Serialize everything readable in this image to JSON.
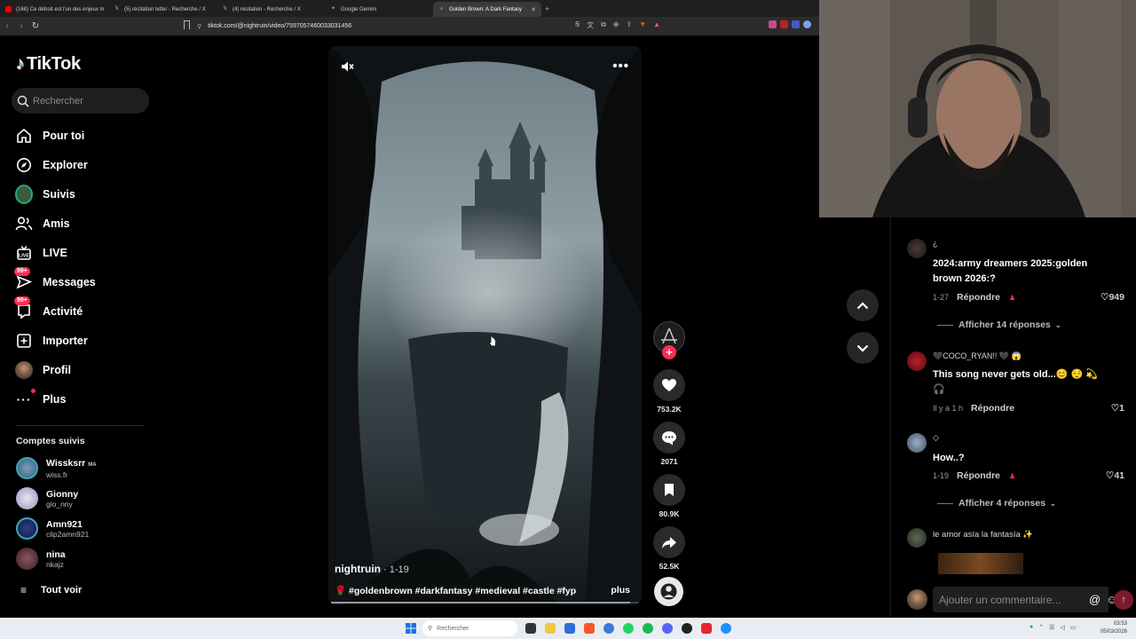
{
  "browser": {
    "tabs": [
      {
        "title": "(168) Ce détroit est l'un des enjeux m",
        "icon": "youtube-icon",
        "active": false
      },
      {
        "title": "(5) récitation letter - Recherche / X",
        "icon": "x-icon",
        "active": false
      },
      {
        "title": "(4) récitation - Recherche / X",
        "icon": "x-icon",
        "active": false
      },
      {
        "title": "Google Gemini",
        "icon": "gemini-icon",
        "active": false
      },
      {
        "title": "Golden Brown: A Dark Fantasy",
        "icon": "tiktok-icon",
        "active": true
      }
    ],
    "new_tab": "+",
    "url": "tiktok.com/@nightruin/video/7597057460033031456"
  },
  "sidebar": {
    "logo": "TikTok",
    "search_placeholder": "Rechercher",
    "nav": [
      {
        "label": "Pour toi",
        "icon": "home-icon"
      },
      {
        "label": "Explorer",
        "icon": "compass-icon"
      },
      {
        "label": "Suivis",
        "icon": "following-avatar-icon"
      },
      {
        "label": "Amis",
        "icon": "friends-icon"
      },
      {
        "label": "LIVE",
        "icon": "live-icon"
      },
      {
        "label": "Messages",
        "icon": "messages-icon",
        "badge": "99+"
      },
      {
        "label": "Activité",
        "icon": "activity-icon",
        "badge": "99+"
      },
      {
        "label": "Importer",
        "icon": "upload-icon"
      },
      {
        "label": "Profil",
        "icon": "profile-avatar-icon"
      },
      {
        "label": "Plus",
        "icon": "more-dots-icon"
      }
    ],
    "following_title": "Comptes suivis",
    "following": [
      {
        "name": "Wissksrr",
        "tag": "MA",
        "handle": "wiss.fr"
      },
      {
        "name": "Gionny",
        "tag": "",
        "handle": "gio_nny"
      },
      {
        "name": "Amn921",
        "tag": "",
        "handle": "clip2amn921"
      },
      {
        "name": "nina",
        "tag": "",
        "handle": "nkajz"
      }
    ],
    "see_all": "Tout voir"
  },
  "video": {
    "author": "nightruin",
    "date": " · 1-19",
    "caption": "🌹 #goldenbrown #darkfantasy #medieval #castle #fyp",
    "more_label": "plus",
    "progress": 0.97
  },
  "actions": {
    "likes": "753.2K",
    "comments": "2071",
    "saves": "80.9K",
    "shares": "52.5K"
  },
  "comments": [
    {
      "user": "¿",
      "text": "2024:army dreamers 2025:golden brown 2026:?",
      "time": "1-27",
      "reply": "Répondre",
      "likes": "949",
      "replies": "Afficher 14 réponses"
    },
    {
      "user": "🖤COCO_RYAN!! 🖤 😱",
      "text": "This song never gets old...😊 😌 💫 🎧",
      "time": "Il y a 1 h",
      "reply": "Répondre",
      "likes": "1",
      "replies": ""
    },
    {
      "user": "◇",
      "text": "How..?",
      "time": "1-19",
      "reply": "Répondre",
      "likes": "41",
      "replies": "Afficher 4 réponses"
    },
    {
      "user": "le amor asía la fantasía ✨",
      "text": "",
      "time": "",
      "reply": "",
      "likes": "",
      "replies": ""
    }
  ],
  "comment_box": {
    "placeholder": "Ajouter un commentaire...",
    "at": "@",
    "emoji": "☺",
    "send": "↑"
  },
  "taskbar": {
    "search_placeholder": "Rechercher",
    "time": "03:53",
    "date": "05/03/2026"
  },
  "colors": {
    "accent": "#fe2c55",
    "cyan": "#25f4ee",
    "panel": "#1e1e1e"
  }
}
